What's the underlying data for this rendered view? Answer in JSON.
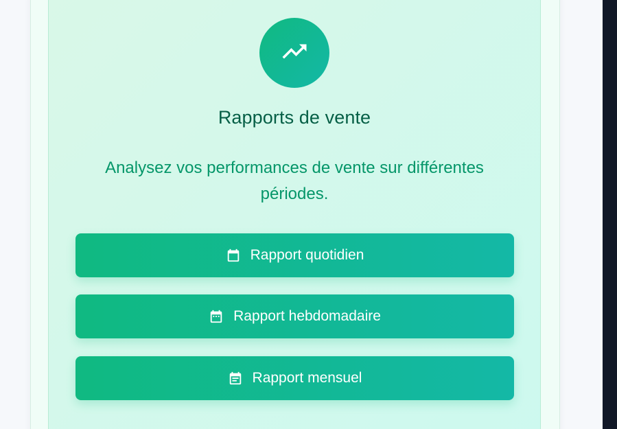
{
  "card": {
    "title": "Rapports de vente",
    "description": "Analysez vos performances de vente sur différentes périodes.",
    "header_icon": "trending-up-icon"
  },
  "buttons": [
    {
      "label": "Rapport quotidien",
      "icon": "calendar-icon"
    },
    {
      "label": "Rapport hebdomadaire",
      "icon": "calendar-week-icon"
    },
    {
      "label": "Rapport mensuel",
      "icon": "calendar-month-icon"
    }
  ],
  "colors": {
    "accent_start": "#10b981",
    "accent_end": "#14b8a6",
    "title": "#065f46",
    "description": "#059669"
  }
}
